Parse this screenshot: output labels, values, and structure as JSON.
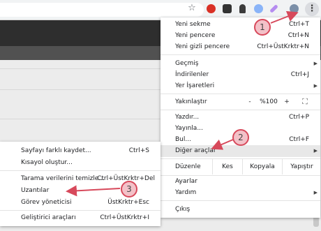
{
  "colors": {
    "annotation": "#d7495b",
    "badge_fill": "#f3c1c8",
    "highlight": "#e8e8e8"
  },
  "toolbar": {
    "star_icon": "☆",
    "extension_icons": [
      "red-shield-icon",
      "cam-extension-icon",
      "bell-icon",
      "chat-bubble-icon",
      "pen-icon",
      "avatar-icon"
    ],
    "menu_icon": "⋮"
  },
  "main_menu": {
    "new_tab": {
      "label": "Yeni sekme",
      "shortcut": "Ctrl+T"
    },
    "new_window": {
      "label": "Yeni pencere",
      "shortcut": "Ctrl+N"
    },
    "incognito": {
      "label": "Yeni gizli pencere",
      "shortcut": "Ctrl+ÜstKrktr+N"
    },
    "history": {
      "label": "Geçmiş"
    },
    "downloads": {
      "label": "İndirilenler",
      "shortcut": "Ctrl+J"
    },
    "bookmarks": {
      "label": "Yer İşaretleri"
    },
    "zoom": {
      "label": "Yakınlaştır",
      "minus": "-",
      "value": "%100",
      "plus": "+",
      "fullscreen": "⛶"
    },
    "print": {
      "label": "Yazdır...",
      "shortcut": "Ctrl+P"
    },
    "cast": {
      "label": "Yayınla..."
    },
    "find": {
      "label": "Bul...",
      "shortcut": "Ctrl+F"
    },
    "more_tools": {
      "label": "Diğer araçlar"
    },
    "edit": {
      "label": "Düzenle",
      "cut": "Kes",
      "copy": "Kopyala",
      "paste": "Yapıştır"
    },
    "settings": {
      "label": "Ayarlar"
    },
    "help": {
      "label": "Yardım"
    },
    "exit": {
      "label": "Çıkış"
    }
  },
  "sub_menu": {
    "save_page": {
      "label": "Sayfayı farklı kaydet...",
      "shortcut": "Ctrl+S"
    },
    "create_shortcut": {
      "label": "Kısayol oluştur..."
    },
    "clear_data": {
      "label": "Tarama verilerini temizle...",
      "shortcut": "Ctrl+ÜstKrktr+Del"
    },
    "extensions": {
      "label": "Uzantılar"
    },
    "task_manager": {
      "label": "Görev yöneticisi",
      "shortcut": "ÜstKrktr+Esc"
    },
    "dev_tools": {
      "label": "Geliştirici araçları",
      "shortcut": "Ctrl+ÜstKrktr+I"
    }
  },
  "annotations": {
    "step1": "1",
    "step2": "2",
    "step3": "3"
  }
}
